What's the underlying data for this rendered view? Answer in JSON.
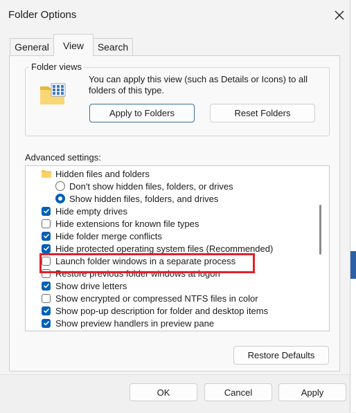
{
  "window": {
    "title": "Folder Options"
  },
  "tabs": [
    {
      "label": "General",
      "active": false
    },
    {
      "label": "View",
      "active": true
    },
    {
      "label": "Search",
      "active": false
    }
  ],
  "folder_views": {
    "legend": "Folder views",
    "description": "You can apply this view (such as Details or Icons) to all folders of this type.",
    "apply_button": "Apply to Folders",
    "reset_button": "Reset Folders"
  },
  "advanced": {
    "label": "Advanced settings:",
    "items": [
      {
        "type": "folder",
        "label": "Hidden files and folders",
        "indent": 1
      },
      {
        "type": "radio",
        "label": "Don't show hidden files, folders, or drives",
        "checked": false,
        "indent": 2
      },
      {
        "type": "radio",
        "label": "Show hidden files, folders, and drives",
        "checked": true,
        "indent": 2
      },
      {
        "type": "checkbox",
        "label": "Hide empty drives",
        "checked": true,
        "indent": 1
      },
      {
        "type": "checkbox",
        "label": "Hide extensions for known file types",
        "checked": false,
        "indent": 1
      },
      {
        "type": "checkbox",
        "label": "Hide folder merge conflicts",
        "checked": true,
        "indent": 1
      },
      {
        "type": "checkbox",
        "label": "Hide protected operating system files (Recommended)",
        "checked": true,
        "indent": 1
      },
      {
        "type": "checkbox",
        "label": "Launch folder windows in a separate process",
        "checked": false,
        "indent": 1
      },
      {
        "type": "checkbox",
        "label": "Restore previous folder windows at logon",
        "checked": false,
        "indent": 1
      },
      {
        "type": "checkbox",
        "label": "Show drive letters",
        "checked": true,
        "indent": 1
      },
      {
        "type": "checkbox",
        "label": "Show encrypted or compressed NTFS files in color",
        "checked": false,
        "indent": 1
      },
      {
        "type": "checkbox",
        "label": "Show pop-up description for folder and desktop items",
        "checked": true,
        "indent": 1
      },
      {
        "type": "checkbox",
        "label": "Show preview handlers in preview pane",
        "checked": true,
        "indent": 1
      },
      {
        "type": "checkbox",
        "label": "",
        "checked": true,
        "indent": 1
      }
    ],
    "restore_button": "Restore Defaults"
  },
  "footer": {
    "ok": "OK",
    "cancel": "Cancel",
    "apply": "Apply"
  },
  "colors": {
    "accent": "#005fb8",
    "highlight": "#e0202b",
    "folder": "#f5c842"
  }
}
